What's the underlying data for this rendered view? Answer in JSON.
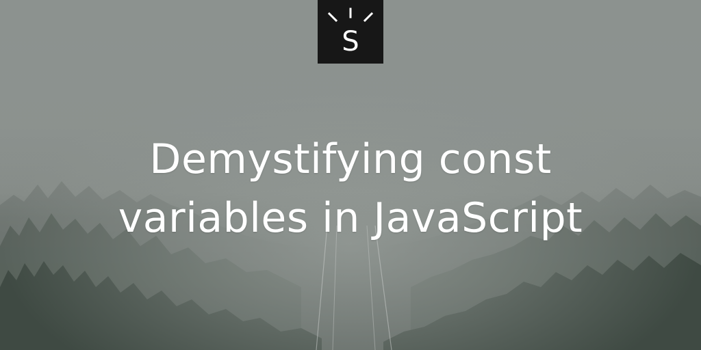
{
  "brand": {
    "logo_letter": "S",
    "logo_background": "#171717",
    "logo_foreground": "#ffffff"
  },
  "post": {
    "title_line_1": "Demystifying const",
    "title_line_2": "variables in JavaScript"
  },
  "background": {
    "description_icon": "foggy-forest-image",
    "fog_color": "#8b918e",
    "forest_color": "#3c4540"
  }
}
